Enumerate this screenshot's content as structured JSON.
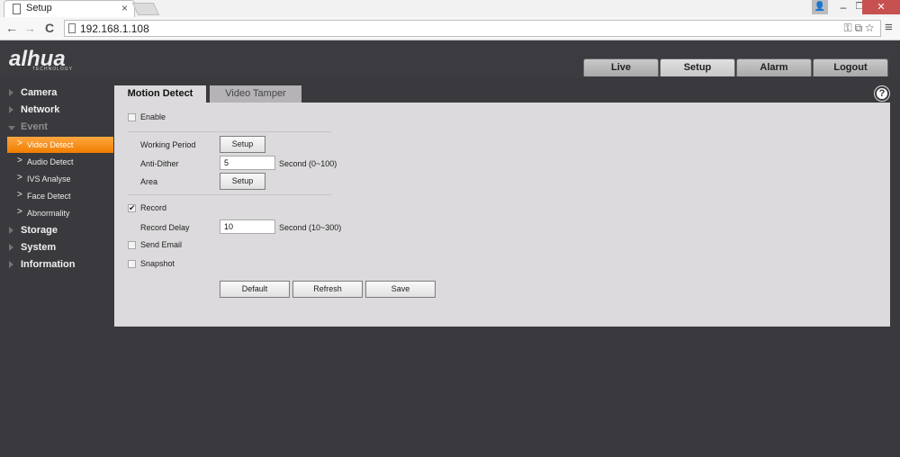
{
  "browser": {
    "tab_title": "Setup",
    "tab_close": "×",
    "url": "192.168.1.108",
    "back": "←",
    "forward": "→",
    "reload": "C",
    "menu": "≡",
    "window": {
      "minimize": "–",
      "maximize": "❐",
      "close": "✕",
      "user": "👤"
    }
  },
  "header": {
    "logo": "alhua",
    "logo_sub": "TECHNOLOGY",
    "nav": [
      "Live",
      "Setup",
      "Alarm",
      "Logout"
    ],
    "active_nav": "Setup"
  },
  "sidebar": {
    "items": [
      {
        "label": "Camera"
      },
      {
        "label": "Network"
      },
      {
        "label": "Event",
        "expanded": true
      },
      {
        "label": "Storage"
      },
      {
        "label": "System"
      },
      {
        "label": "Information"
      }
    ],
    "event_children": [
      {
        "label": "Video Detect",
        "active": true
      },
      {
        "label": "Audio Detect"
      },
      {
        "label": "IVS Analyse"
      },
      {
        "label": "Face Detect"
      },
      {
        "label": "Abnormality"
      }
    ],
    "chevron": ">"
  },
  "content": {
    "tabs": [
      "Motion Detect",
      "Video Tamper"
    ],
    "help": "?",
    "enable": {
      "label": "Enable",
      "checked": false
    },
    "working_period": {
      "label": "Working Period",
      "button": "Setup"
    },
    "anti_dither": {
      "label": "Anti-Dither",
      "value": "5",
      "unit": "Second (0~100)"
    },
    "area": {
      "label": "Area",
      "button": "Setup"
    },
    "record": {
      "label": "Record",
      "checked": true,
      "mark": "✔"
    },
    "record_delay": {
      "label": "Record Delay",
      "value": "10",
      "unit": "Second (10~300)"
    },
    "send_email": {
      "label": "Send Email",
      "checked": false
    },
    "snapshot": {
      "label": "Snapshot",
      "checked": false
    },
    "buttons": {
      "default": "Default",
      "refresh": "Refresh",
      "save": "Save"
    }
  }
}
